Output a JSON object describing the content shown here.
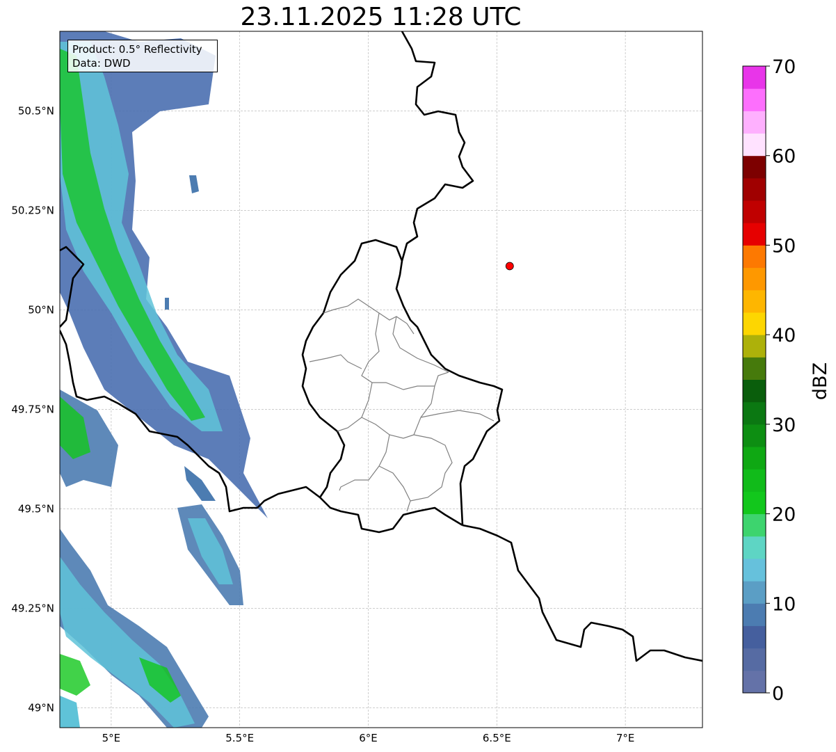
{
  "title": "23.11.2025 11:28 UTC",
  "info_box": {
    "product": "Product: 0.5° Reflectivity",
    "data_source": "Data: DWD"
  },
  "map": {
    "lon_range": [
      4.8,
      7.3
    ],
    "lat_range": [
      48.95,
      50.7
    ],
    "x_ticks": [
      {
        "value": 5.0,
        "label": "5°E"
      },
      {
        "value": 5.5,
        "label": "5.5°E"
      },
      {
        "value": 6.0,
        "label": "6°E"
      },
      {
        "value": 6.5,
        "label": "6.5°E"
      },
      {
        "value": 7.0,
        "label": "7°E"
      }
    ],
    "y_ticks": [
      {
        "value": 49.0,
        "label": "49°N"
      },
      {
        "value": 49.25,
        "label": "49.25°N"
      },
      {
        "value": 49.5,
        "label": "49.5°N"
      },
      {
        "value": 49.75,
        "label": "49.75°N"
      },
      {
        "value": 50.0,
        "label": "50°N"
      },
      {
        "value": 50.25,
        "label": "50.25°N"
      },
      {
        "value": 50.5,
        "label": "50.5°N"
      }
    ],
    "grid": true,
    "marker": {
      "lon": 6.55,
      "lat": 50.11,
      "color": "#ff0000"
    },
    "border_color": "#000000",
    "subdivision_color": "#808080"
  },
  "colorbar": {
    "label": "dBZ",
    "range": [
      0,
      70
    ],
    "ticks": [
      0,
      10,
      20,
      30,
      40,
      50,
      60,
      70
    ],
    "colors": [
      "#6472a8",
      "#566ba3",
      "#455f9e",
      "#4c7cb1",
      "#5b9ec5",
      "#66c1dc",
      "#5ed5c4",
      "#3dd46e",
      "#12c71c",
      "#11bb1a",
      "#0fa813",
      "#0d8e12",
      "#0b7812",
      "#0a5e0c",
      "#467a0c",
      "#adb10a",
      "#fdd601",
      "#feb600",
      "#fe9800",
      "#fd7901",
      "#e60000",
      "#c00000",
      "#a00000",
      "#7d0000",
      "#ffe2ff",
      "#feb0fe",
      "#fd6ffd",
      "#e835e9"
    ]
  }
}
